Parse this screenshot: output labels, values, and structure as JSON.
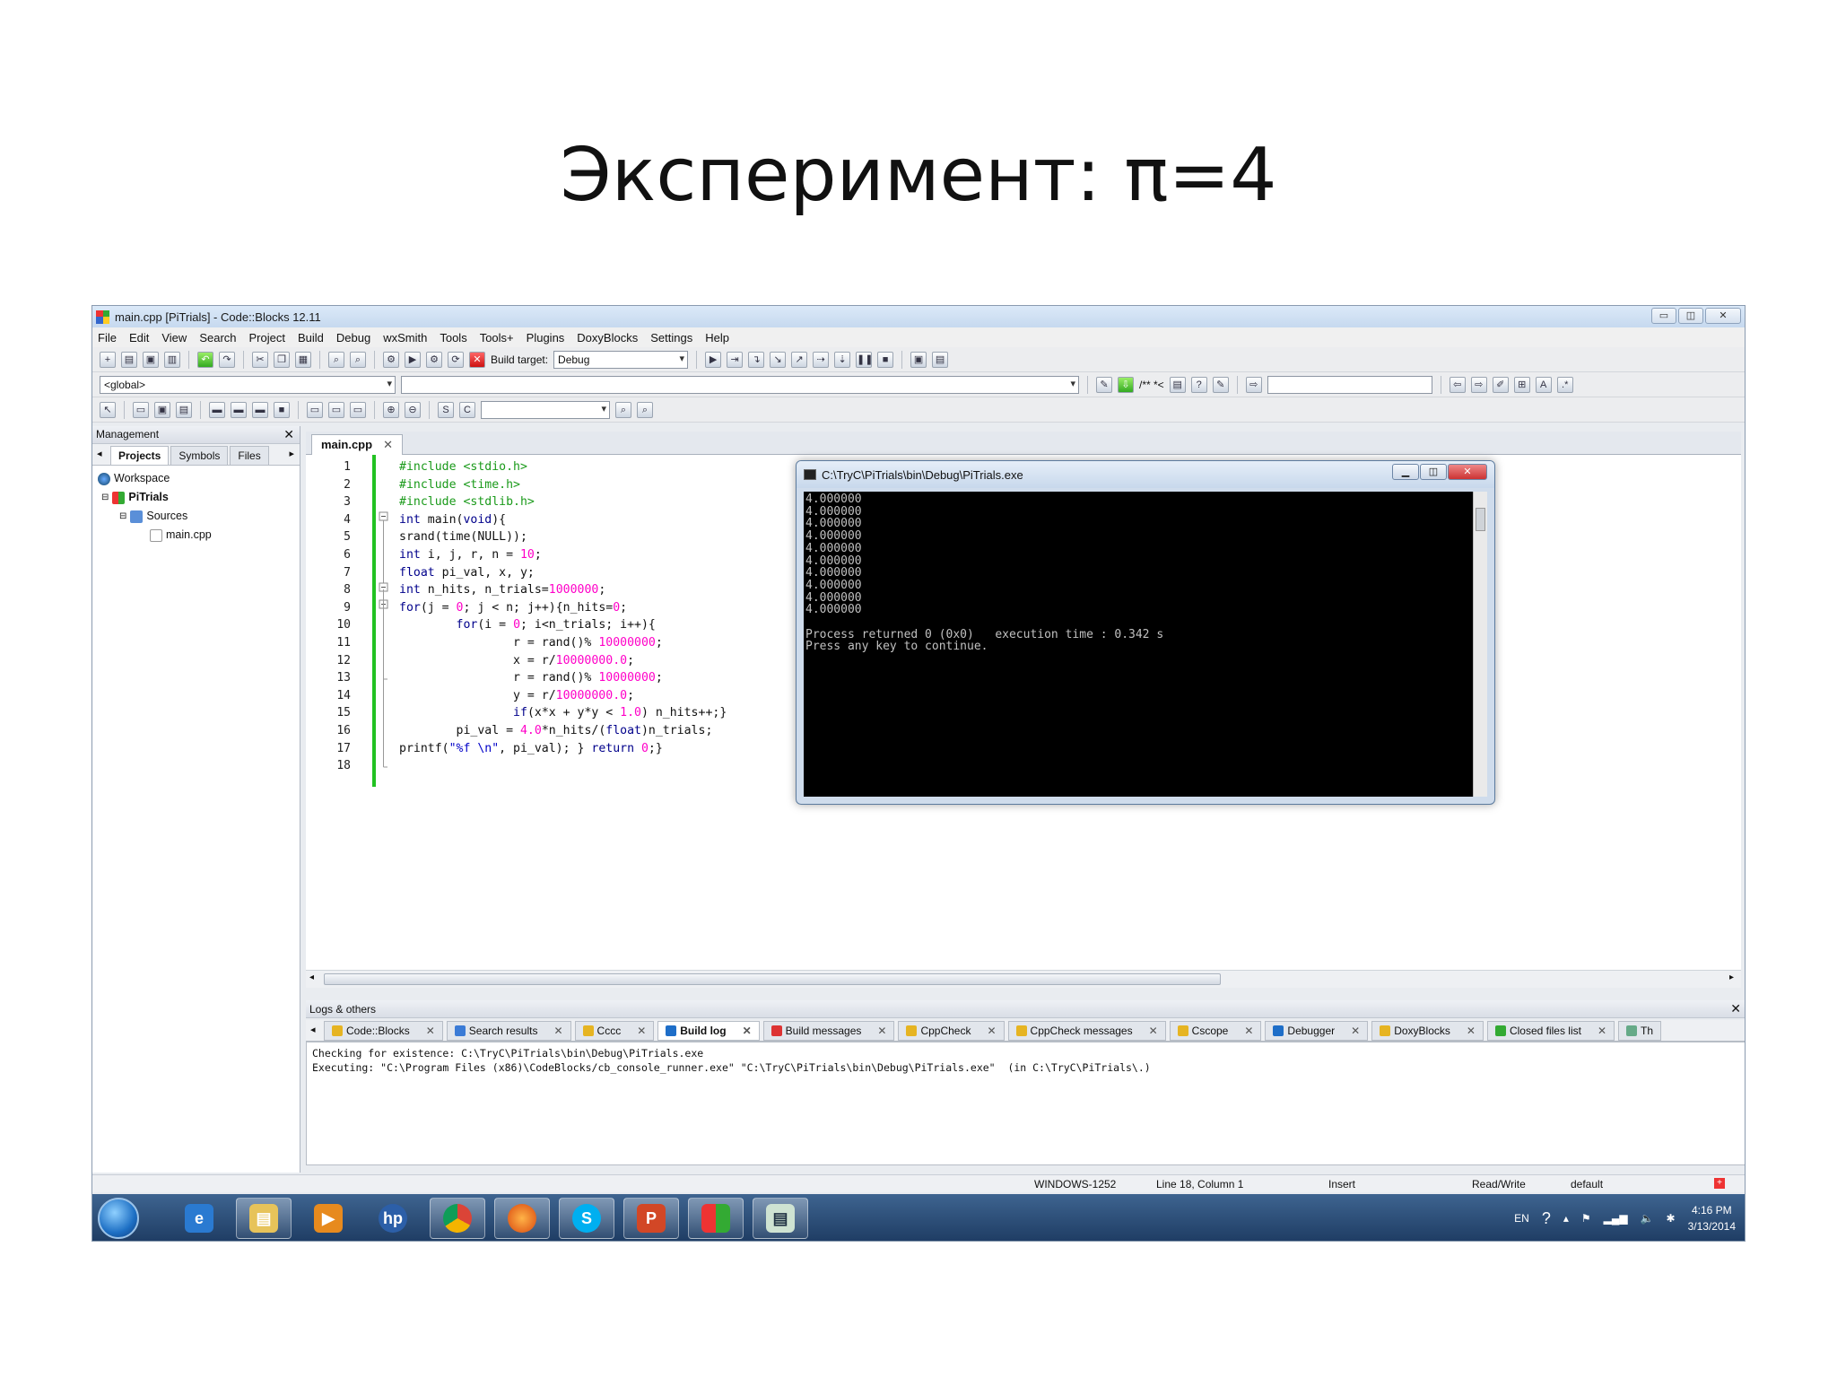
{
  "slide_title": "Эксперимент: π=4",
  "window": {
    "title": "main.cpp [PiTrials] - Code::Blocks 12.11",
    "buttons": [
      "▭",
      "◫",
      "✕"
    ]
  },
  "menu": [
    "File",
    "Edit",
    "View",
    "Search",
    "Project",
    "Build",
    "Debug",
    "wxSmith",
    "Tools",
    "Tools+",
    "Plugins",
    "DoxyBlocks",
    "Settings",
    "Help"
  ],
  "toolbar": {
    "build_target_label": "Build target:",
    "build_target_value": "Debug",
    "scope_value": "<global>",
    "doxy_label": "/** *<"
  },
  "management": {
    "title": "Management",
    "tabs": [
      "Projects",
      "Symbols",
      "Files"
    ],
    "tree": [
      "Workspace",
      "PiTrials",
      "Sources",
      "main.cpp"
    ]
  },
  "editor": {
    "tab": "main.cpp",
    "line_numbers": [
      "1",
      "2",
      "3",
      "4",
      "5",
      "6",
      "7",
      "8",
      "9",
      "10",
      "11",
      "12",
      "13",
      "14",
      "15",
      "16",
      "17",
      "18"
    ],
    "lines": [
      "#include <stdio.h>",
      "#include <time.h>",
      "#include <stdlib.h>",
      "int main(void){",
      "srand(time(NULL));",
      "int i, j, r, n = 10;",
      "float pi_val, x, y;",
      "int n_hits, n_trials=1000000;",
      "for(j = 0; j < n; j++){n_hits=0;",
      "        for(i = 0; i<n_trials; i++){",
      "                r = rand()% 10000000;",
      "                x = r/10000000.0;",
      "                r = rand()% 10000000;",
      "                y = r/10000000.0;",
      "                if(x*x + y*y < 1.0) n_hits++;}",
      "        pi_val = 4.0*n_hits/(float)n_trials;",
      "printf(\"%f \\n\", pi_val); } return 0;}",
      ""
    ]
  },
  "console": {
    "title": "C:\\TryC\\PiTrials\\bin\\Debug\\PiTrials.exe",
    "output": "4.000000\n4.000000\n4.000000\n4.000000\n4.000000\n4.000000\n4.000000\n4.000000\n4.000000\n4.000000\n\nProcess returned 0 (0x0)   execution time : 0.342 s\nPress any key to continue."
  },
  "logs": {
    "title": "Logs & others",
    "tabs": [
      "Code::Blocks",
      "Search results",
      "Cccc",
      "Build log",
      "Build messages",
      "CppCheck",
      "CppCheck messages",
      "Cscope",
      "Debugger",
      "DoxyBlocks",
      "Closed files list",
      "Th"
    ],
    "active_tab": "Build log",
    "body": "Checking for existence: C:\\TryC\\PiTrials\\bin\\Debug\\PiTrials.exe\nExecuting: \"C:\\Program Files (x86)\\CodeBlocks/cb_console_runner.exe\" \"C:\\TryC\\PiTrials\\bin\\Debug\\PiTrials.exe\"  (in C:\\TryC\\PiTrials\\.)"
  },
  "status": {
    "encoding": "WINDOWS-1252",
    "position": "Line 18, Column 1",
    "mode": "Insert",
    "access": "Read/Write",
    "profile": "default"
  },
  "taskbar": {
    "lang": "EN",
    "time": "4:16 PM",
    "date": "3/13/2014"
  }
}
